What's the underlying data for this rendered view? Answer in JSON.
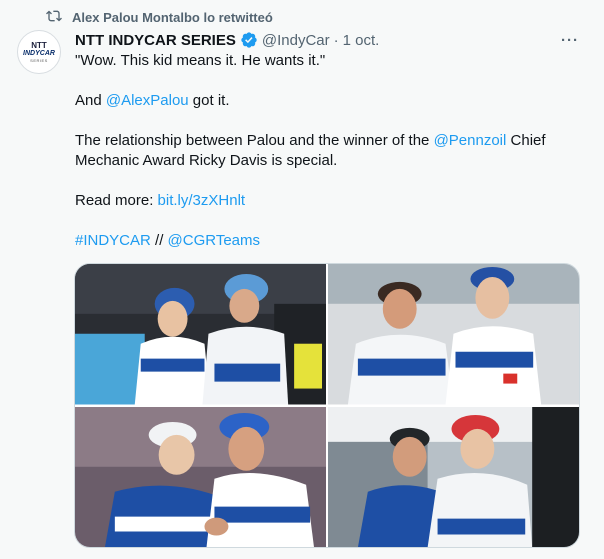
{
  "retweet": {
    "icon": "retweet-icon",
    "label": "Alex Palou Montalbo lo retwitteó"
  },
  "author": {
    "avatar_ntt": "NTT",
    "avatar_indy": "INDYCAR",
    "avatar_series": "SERIES",
    "name": "NTT INDYCAR SERIES",
    "handle": "@IndyCar",
    "separator": "·",
    "date": "1 oct."
  },
  "more_label": "···",
  "tweet": {
    "line1": "\"Wow. This kid means it. He wants it.\"",
    "line2_pre": "And ",
    "line2_mention": "@AlexPalou",
    "line2_post": " got it.",
    "line3_pre": "The relationship between Palou and the winner of the ",
    "line3_mention": "@Pennzoil",
    "line3_post": " Chief Mechanic Award Ricky Davis is special.",
    "line4_pre": "Read more: ",
    "line4_link": "bit.ly/3zXHnlt",
    "hashtag": "#INDYCAR",
    "slashes": " // ",
    "mention_team": "@CGRTeams"
  },
  "colors": {
    "link": "#1d9bf0",
    "text": "#0f1419",
    "muted": "#536471",
    "background": "#f7f9f9"
  }
}
